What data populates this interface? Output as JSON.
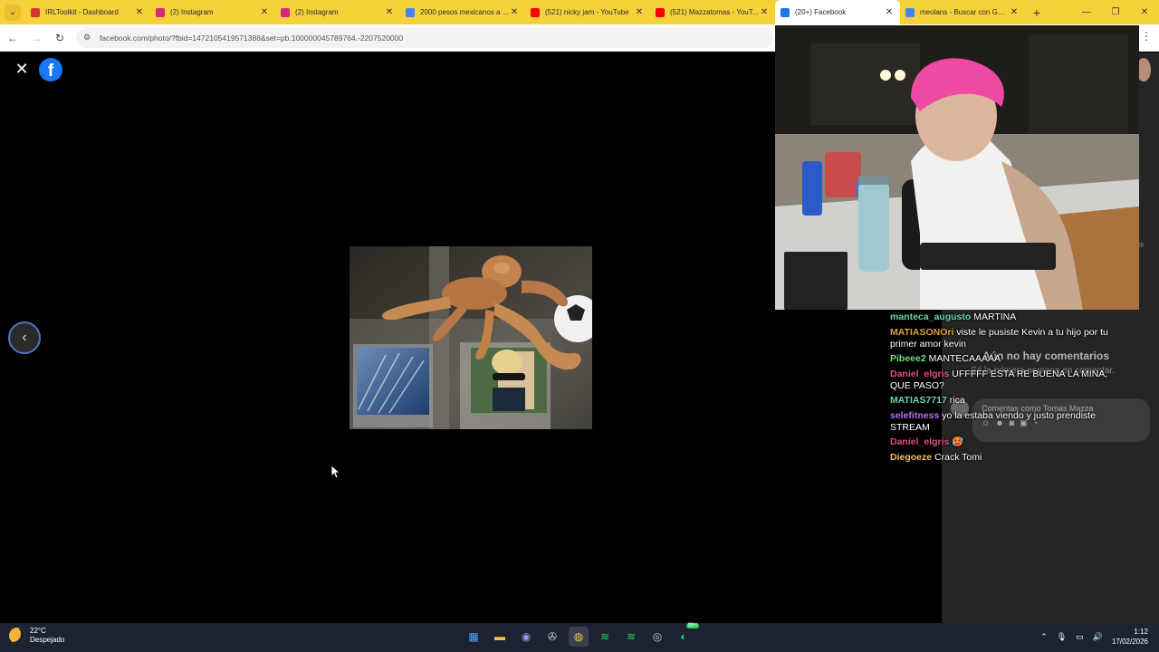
{
  "browser": {
    "tabs": [
      {
        "title": "IRLToolkit - Dashboard",
        "favicon_color": "#d9342b",
        "active": false
      },
      {
        "title": "(2) Instagram",
        "favicon_color": "#d62976",
        "active": false
      },
      {
        "title": "(2) Instagram",
        "favicon_color": "#d62976",
        "active": false
      },
      {
        "title": "2000 pesos mexicanos a ...",
        "favicon_color": "#4285f4",
        "active": false
      },
      {
        "title": "(521) nicky jam - YouTube",
        "favicon_color": "#ff0000",
        "active": false
      },
      {
        "title": "(521) Mazzatomas - YouT...",
        "favicon_color": "#ff0000",
        "active": false
      },
      {
        "title": "(20+) Facebook",
        "favicon_color": "#1877f2",
        "active": true
      },
      {
        "title": "meolans - Buscar con Goo...",
        "favicon_color": "#4285f4",
        "active": false
      }
    ],
    "url": "facebook.com/photo/?fbid=1472105419571388&set=pb.100000045789764.-2207520000"
  },
  "facebook": {
    "no_comments_title": "Aún no hay comentarios",
    "no_comments_sub": "Sé la primera persona en comentar.",
    "comment_placeholder": "Comentas como Tomas Mazza",
    "side_fragment": "tir"
  },
  "chat": [
    {
      "user": "manteca_augusto",
      "color": "#6fd5a8",
      "text": "MARTINA"
    },
    {
      "user": "MATIASONOri",
      "color": "#e0a030",
      "text": "viste le pusiste Kevin a tu hijo por tu primer amor kevin"
    },
    {
      "user": "Pibeee2",
      "color": "#6fe07a",
      "text": "MANTECAAAAA"
    },
    {
      "user": "Daniel_elgris",
      "color": "#e0507a",
      "text": "UFFFFF ESTA RE BUENA LA MINA, QUE PASO?"
    },
    {
      "user": "MATIAS7717",
      "color": "#6fd5a8",
      "text": "rica"
    },
    {
      "user": "selefitness",
      "color": "#b36ef0",
      "text": "yo la estaba viendo y justo prendiste STREAM"
    },
    {
      "user": "Daniel_elgris",
      "color": "#e0507a",
      "text": "🥵"
    },
    {
      "user": "Diegoeze",
      "color": "#f0c060",
      "text": "Crack Tomi"
    }
  ],
  "taskbar": {
    "temperature": "22°C",
    "weather": "Despejado",
    "time": "1:12",
    "date": "17/02/2026",
    "chat_badge": "99+"
  }
}
